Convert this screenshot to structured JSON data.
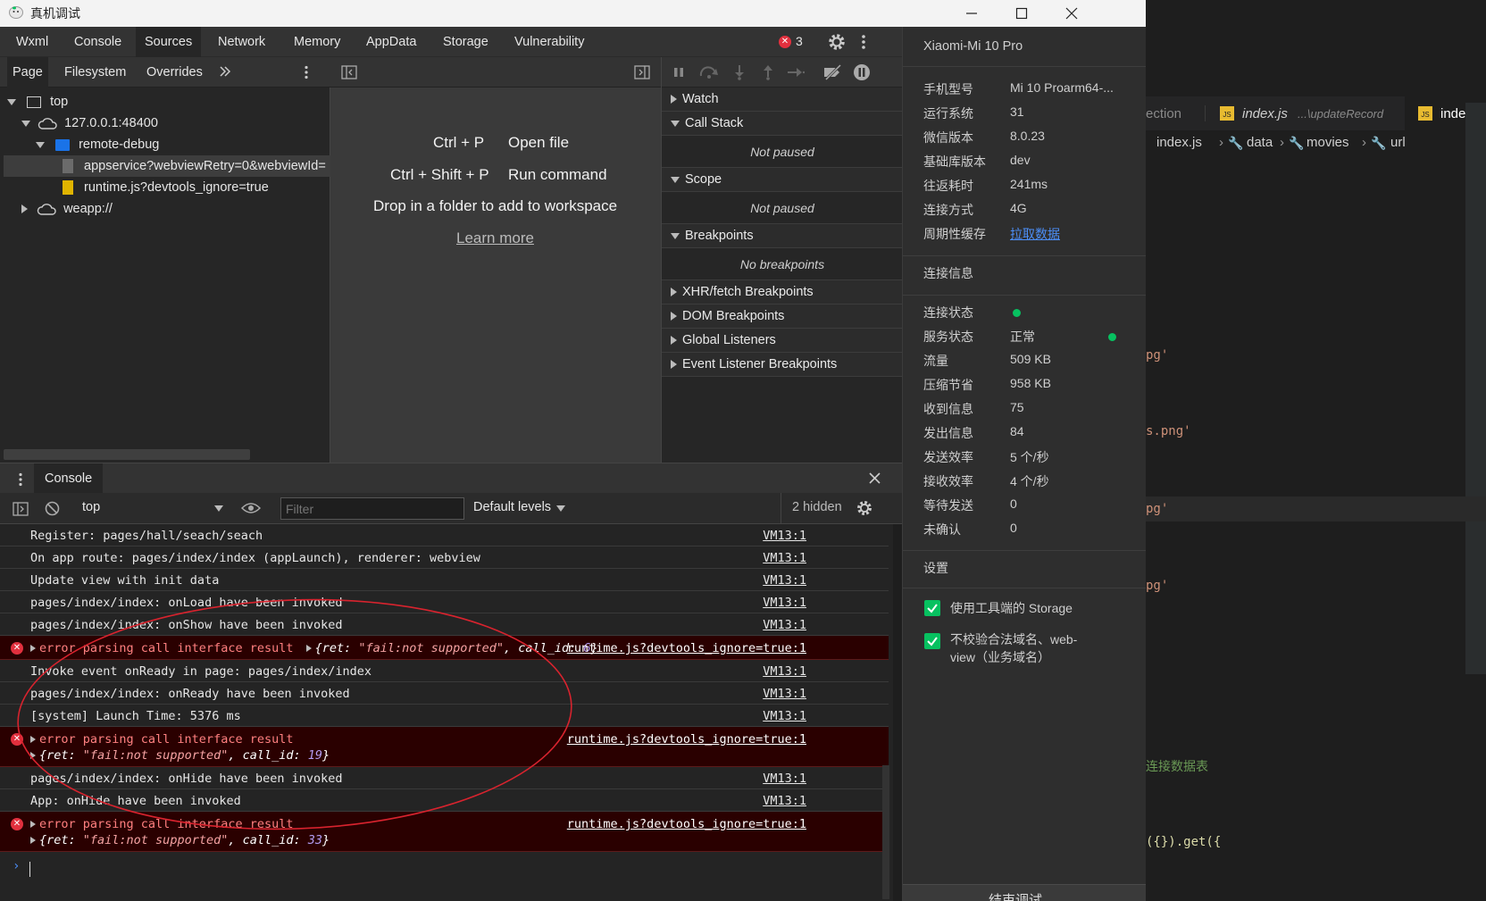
{
  "window": {
    "title": "真机调试"
  },
  "main_tabs": [
    "Wxml",
    "Console",
    "Sources",
    "Network",
    "Memory",
    "AppData",
    "Storage",
    "Vulnerability"
  ],
  "error_count": "3",
  "sources": {
    "subtabs": [
      "Page",
      "Filesystem",
      "Overrides"
    ],
    "tree": {
      "top": "top",
      "origin": "127.0.0.1:48400",
      "folder": "remote-debug",
      "file1": "appservice?webviewRetry=0&webviewId=",
      "file2": "runtime.js?devtools_ignore=true",
      "weapp": "weapp://"
    },
    "editor": {
      "shortcut1": "Ctrl + P",
      "action1": "Open file",
      "shortcut2": "Ctrl + Shift + P",
      "action2": "Run command",
      "drop_hint": "Drop in a folder to add to workspace",
      "learn_more": "Learn more"
    },
    "debugger": {
      "watch": "Watch",
      "call_stack": "Call Stack",
      "call_stack_body": "Not paused",
      "scope": "Scope",
      "scope_body": "Not paused",
      "breakpoints": "Breakpoints",
      "breakpoints_body": "No breakpoints",
      "xhr": "XHR/fetch Breakpoints",
      "dom": "DOM Breakpoints",
      "global": "Global Listeners",
      "event": "Event Listener Breakpoints"
    }
  },
  "console": {
    "drawer_tab": "Console",
    "context": "top",
    "filter_placeholder": "Filter",
    "levels": "Default levels",
    "hidden": "2 hidden",
    "rows": [
      {
        "type": "log",
        "text": "Register: pages/hall/seach/seach",
        "source": "VM13:1"
      },
      {
        "type": "log",
        "text": "On app route: pages/index/index (appLaunch), renderer: webview",
        "source": "VM13:1"
      },
      {
        "type": "log",
        "text": "Update view with init data",
        "source": "VM13:1"
      },
      {
        "type": "log",
        "text": "pages/index/index: onLoad have been invoked",
        "source": "VM13:1"
      },
      {
        "type": "log",
        "text": "pages/index/index: onShow have been invoked",
        "source": "VM13:1"
      },
      {
        "type": "error",
        "text": "error parsing call interface result",
        "obj_ret": "\"fail:not supported\"",
        "obj_id": "6",
        "source": "runtime.js?devtools_ignore=true:1"
      },
      {
        "type": "log",
        "text": "Invoke event onReady in page: pages/index/index",
        "source": "VM13:1"
      },
      {
        "type": "log",
        "text": "pages/index/index: onReady have been invoked",
        "source": "VM13:1"
      },
      {
        "type": "log",
        "text": "[system] Launch Time: 5376 ms",
        "source": "VM13:1"
      },
      {
        "type": "error",
        "text": "error parsing call interface result",
        "obj_ret": "\"fail:not supported\"",
        "obj_id": "19",
        "source": "runtime.js?devtools_ignore=true:1"
      },
      {
        "type": "log",
        "text": "pages/index/index: onHide have been invoked",
        "source": "VM13:1"
      },
      {
        "type": "log",
        "text": "App: onHide have been invoked",
        "source": "VM13:1"
      },
      {
        "type": "error",
        "text": "error parsing call interface result",
        "obj_ret": "\"fail:not supported\"",
        "obj_id": "33",
        "source": "runtime.js?devtools_ignore=true:1"
      }
    ],
    "obj_key_ret": "ret: ",
    "obj_key_id": "call_id: "
  },
  "device": {
    "name": "Xiaomi-Mi 10 Pro",
    "info": [
      {
        "label": "手机型号",
        "value": "Mi 10 Proarm64-..."
      },
      {
        "label": "运行系统",
        "value": "31"
      },
      {
        "label": "微信版本",
        "value": "8.0.23"
      },
      {
        "label": "基础库版本",
        "value": "dev"
      },
      {
        "label": "往返耗时",
        "value": "241ms"
      },
      {
        "label": "连接方式",
        "value": "4G"
      },
      {
        "label": "周期性缓存",
        "value": "拉取数据"
      }
    ],
    "conn_title": "连接信息",
    "conn": [
      {
        "label": "连接状态",
        "value": ""
      },
      {
        "label": "服务状态",
        "value": "正常"
      },
      {
        "label": "流量",
        "value": "509 KB"
      },
      {
        "label": "压缩节省",
        "value": "958 KB"
      },
      {
        "label": "收到信息",
        "value": "75"
      },
      {
        "label": "发出信息",
        "value": "84"
      },
      {
        "label": "发送效率",
        "value": "5 个/秒"
      },
      {
        "label": "接收效率",
        "value": "4 个/秒"
      },
      {
        "label": "等待发送",
        "value": "0"
      },
      {
        "label": "未确认",
        "value": "0"
      }
    ],
    "settings_title": "设置",
    "setting1": "使用工具端的 Storage",
    "setting2_line1": "不校验合法域名、web-",
    "setting2_line2": "view（业务域名）",
    "end_button": "结束调试"
  },
  "bg_editor": {
    "tab1": "ection",
    "tab2": "index.js",
    "tab2_path": "...\\updateRecord",
    "tab3": "inde",
    "crumb_file": "index.js",
    "crumb_a": "data",
    "crumb_b": "movies",
    "crumb_c": "url",
    "code1": "pg'",
    "code2": "s.png'",
    "code3": "pg'",
    "code4": "pg'",
    "code5": "连接数据表",
    "code6": "({}).get({"
  },
  "colors": {
    "accent_green": "#07c160",
    "error_red": "#e2303e",
    "link_blue": "#4c8ef7"
  }
}
